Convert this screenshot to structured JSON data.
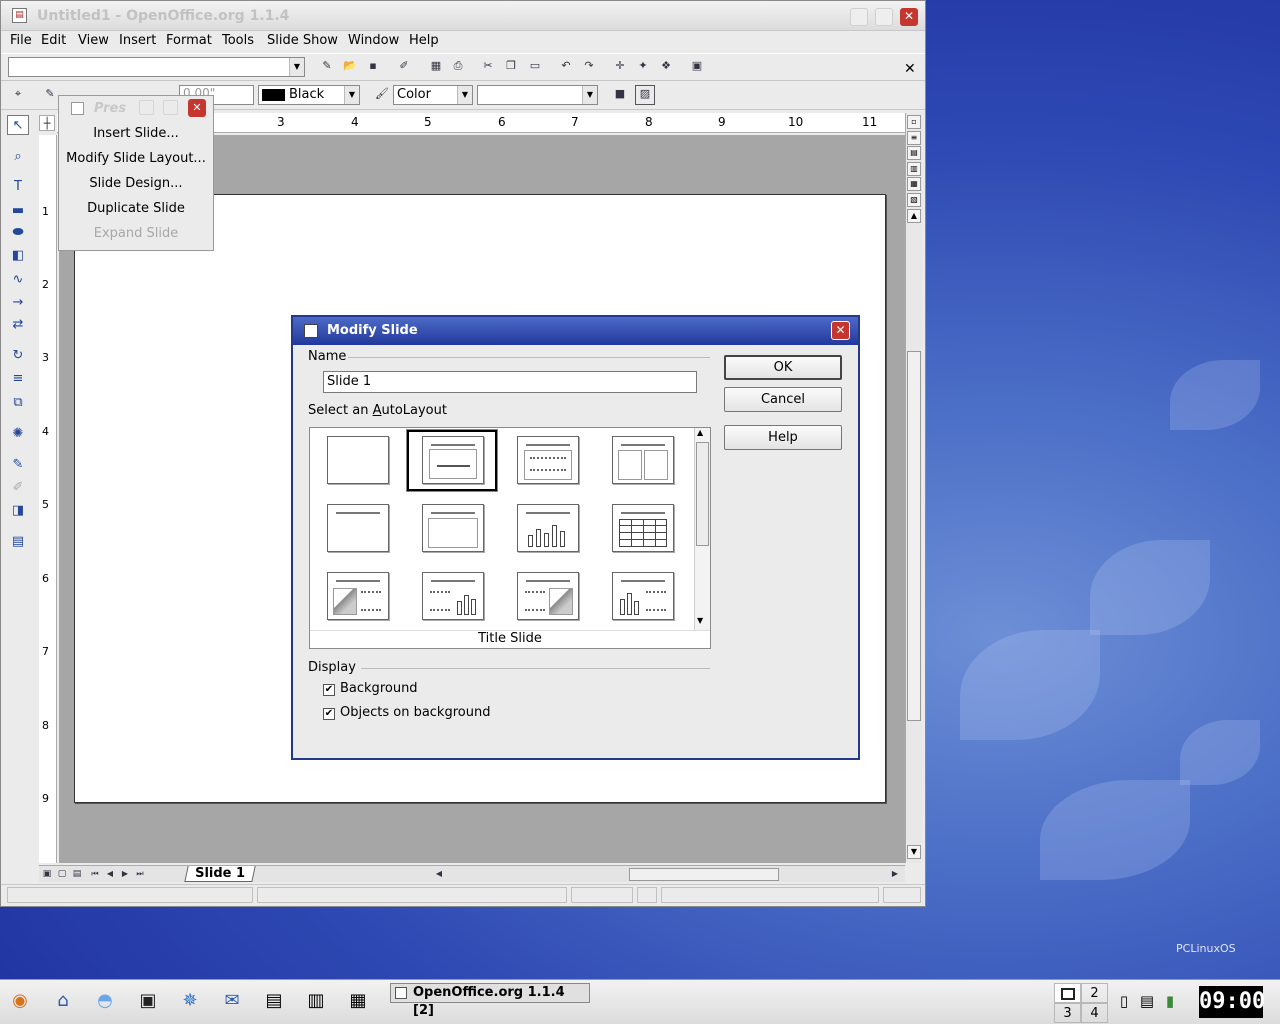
{
  "window": {
    "title": "Untitled1 - OpenOffice.org 1.1.4",
    "menu": [
      "File",
      "Edit",
      "View",
      "Insert",
      "Format",
      "Tools",
      "Slide Show",
      "Window",
      "Help"
    ],
    "line_color": "Black",
    "area_style": "Color",
    "line_width": "0.00\"",
    "ruler_h": [
      "3",
      "4",
      "5",
      "6",
      "7",
      "8",
      "9",
      "10",
      "11"
    ],
    "ruler_v": [
      "1",
      "2",
      "3",
      "4",
      "5",
      "6",
      "7",
      "8",
      "9"
    ],
    "slide_tab": "Slide 1"
  },
  "flyout": {
    "title": "Pres",
    "items": [
      "Insert Slide...",
      "Modify Slide Layout...",
      "Slide Design...",
      "Duplicate Slide",
      "Expand Slide"
    ]
  },
  "dialog": {
    "title": "Modify Slide",
    "name_label": "Name",
    "name_value": "Slide 1",
    "autolayout_label": "Select an AutoLayout",
    "selected_layout": "Title Slide",
    "display_label": "Display",
    "background_label": "Background",
    "background_checked": true,
    "objects_label": "Objects on background",
    "objects_checked": true,
    "ok": "OK",
    "cancel": "Cancel",
    "help": "Help"
  },
  "taskbar": {
    "task": "OpenOffice.org 1.1.4 [2]",
    "desktops": [
      "1",
      "2",
      "3",
      "4"
    ],
    "clock": "09:00"
  },
  "desktop": {
    "logo": "PCLinuxOS"
  },
  "icons": [
    "pointer-icon",
    "zoom-icon",
    "text-icon",
    "rectangle-icon",
    "ellipse-icon",
    "3d-icon",
    "curve-icon",
    "line-icon",
    "connector-icon",
    "rotate-icon",
    "align-icon",
    "arrange-icon",
    "effects-icon",
    "interaction-icon",
    "3d-object-icon",
    "slide-show-icon"
  ]
}
